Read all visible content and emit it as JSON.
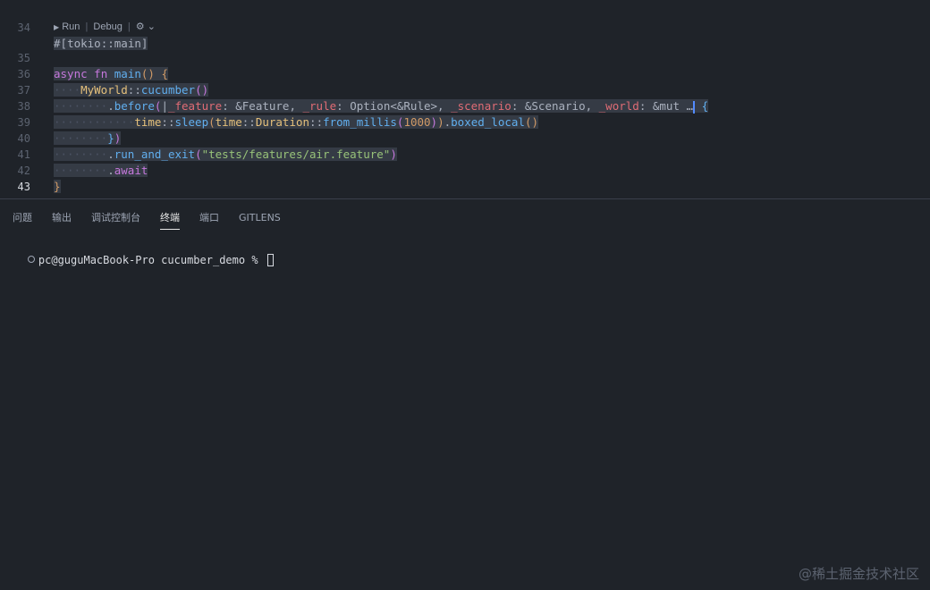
{
  "editor": {
    "lines": [
      {
        "num": "34",
        "code": "#[tokio::main]"
      },
      {
        "num": "35",
        "code": "async fn main() {"
      },
      {
        "num": "36",
        "code": "    MyWorld::cucumber()"
      },
      {
        "num": "37",
        "code": "        .before(|_feature: &Feature, _rule: Option<&Rule>, _scenario: &Scenario, _world: &mut …| {"
      },
      {
        "num": "38",
        "code": "            time::sleep(time::Duration::from_millis(1000)).boxed_local()"
      },
      {
        "num": "39",
        "code": "        })"
      },
      {
        "num": "40",
        "code": "        .run_and_exit(\"tests/features/air.feature\")"
      },
      {
        "num": "41",
        "code": "        .await"
      },
      {
        "num": "42",
        "code": "}"
      },
      {
        "num": "43",
        "code": ""
      }
    ],
    "codelens": {
      "run": "Run",
      "debug": "Debug",
      "sep": "|"
    }
  },
  "panel": {
    "tabs": [
      "问题",
      "输出",
      "调试控制台",
      "终端",
      "端口",
      "GITLENS"
    ],
    "active_tab": "终端"
  },
  "terminal": {
    "prompt": "pc@guguMacBook-Pro cucumber_demo % "
  },
  "watermark": "@稀土掘金技术社区",
  "colors": {
    "background": "#1f2329",
    "keyword": "#c678dd",
    "function": "#61afef",
    "type": "#e5c07b",
    "string": "#98c379",
    "parameter": "#e06c75"
  }
}
